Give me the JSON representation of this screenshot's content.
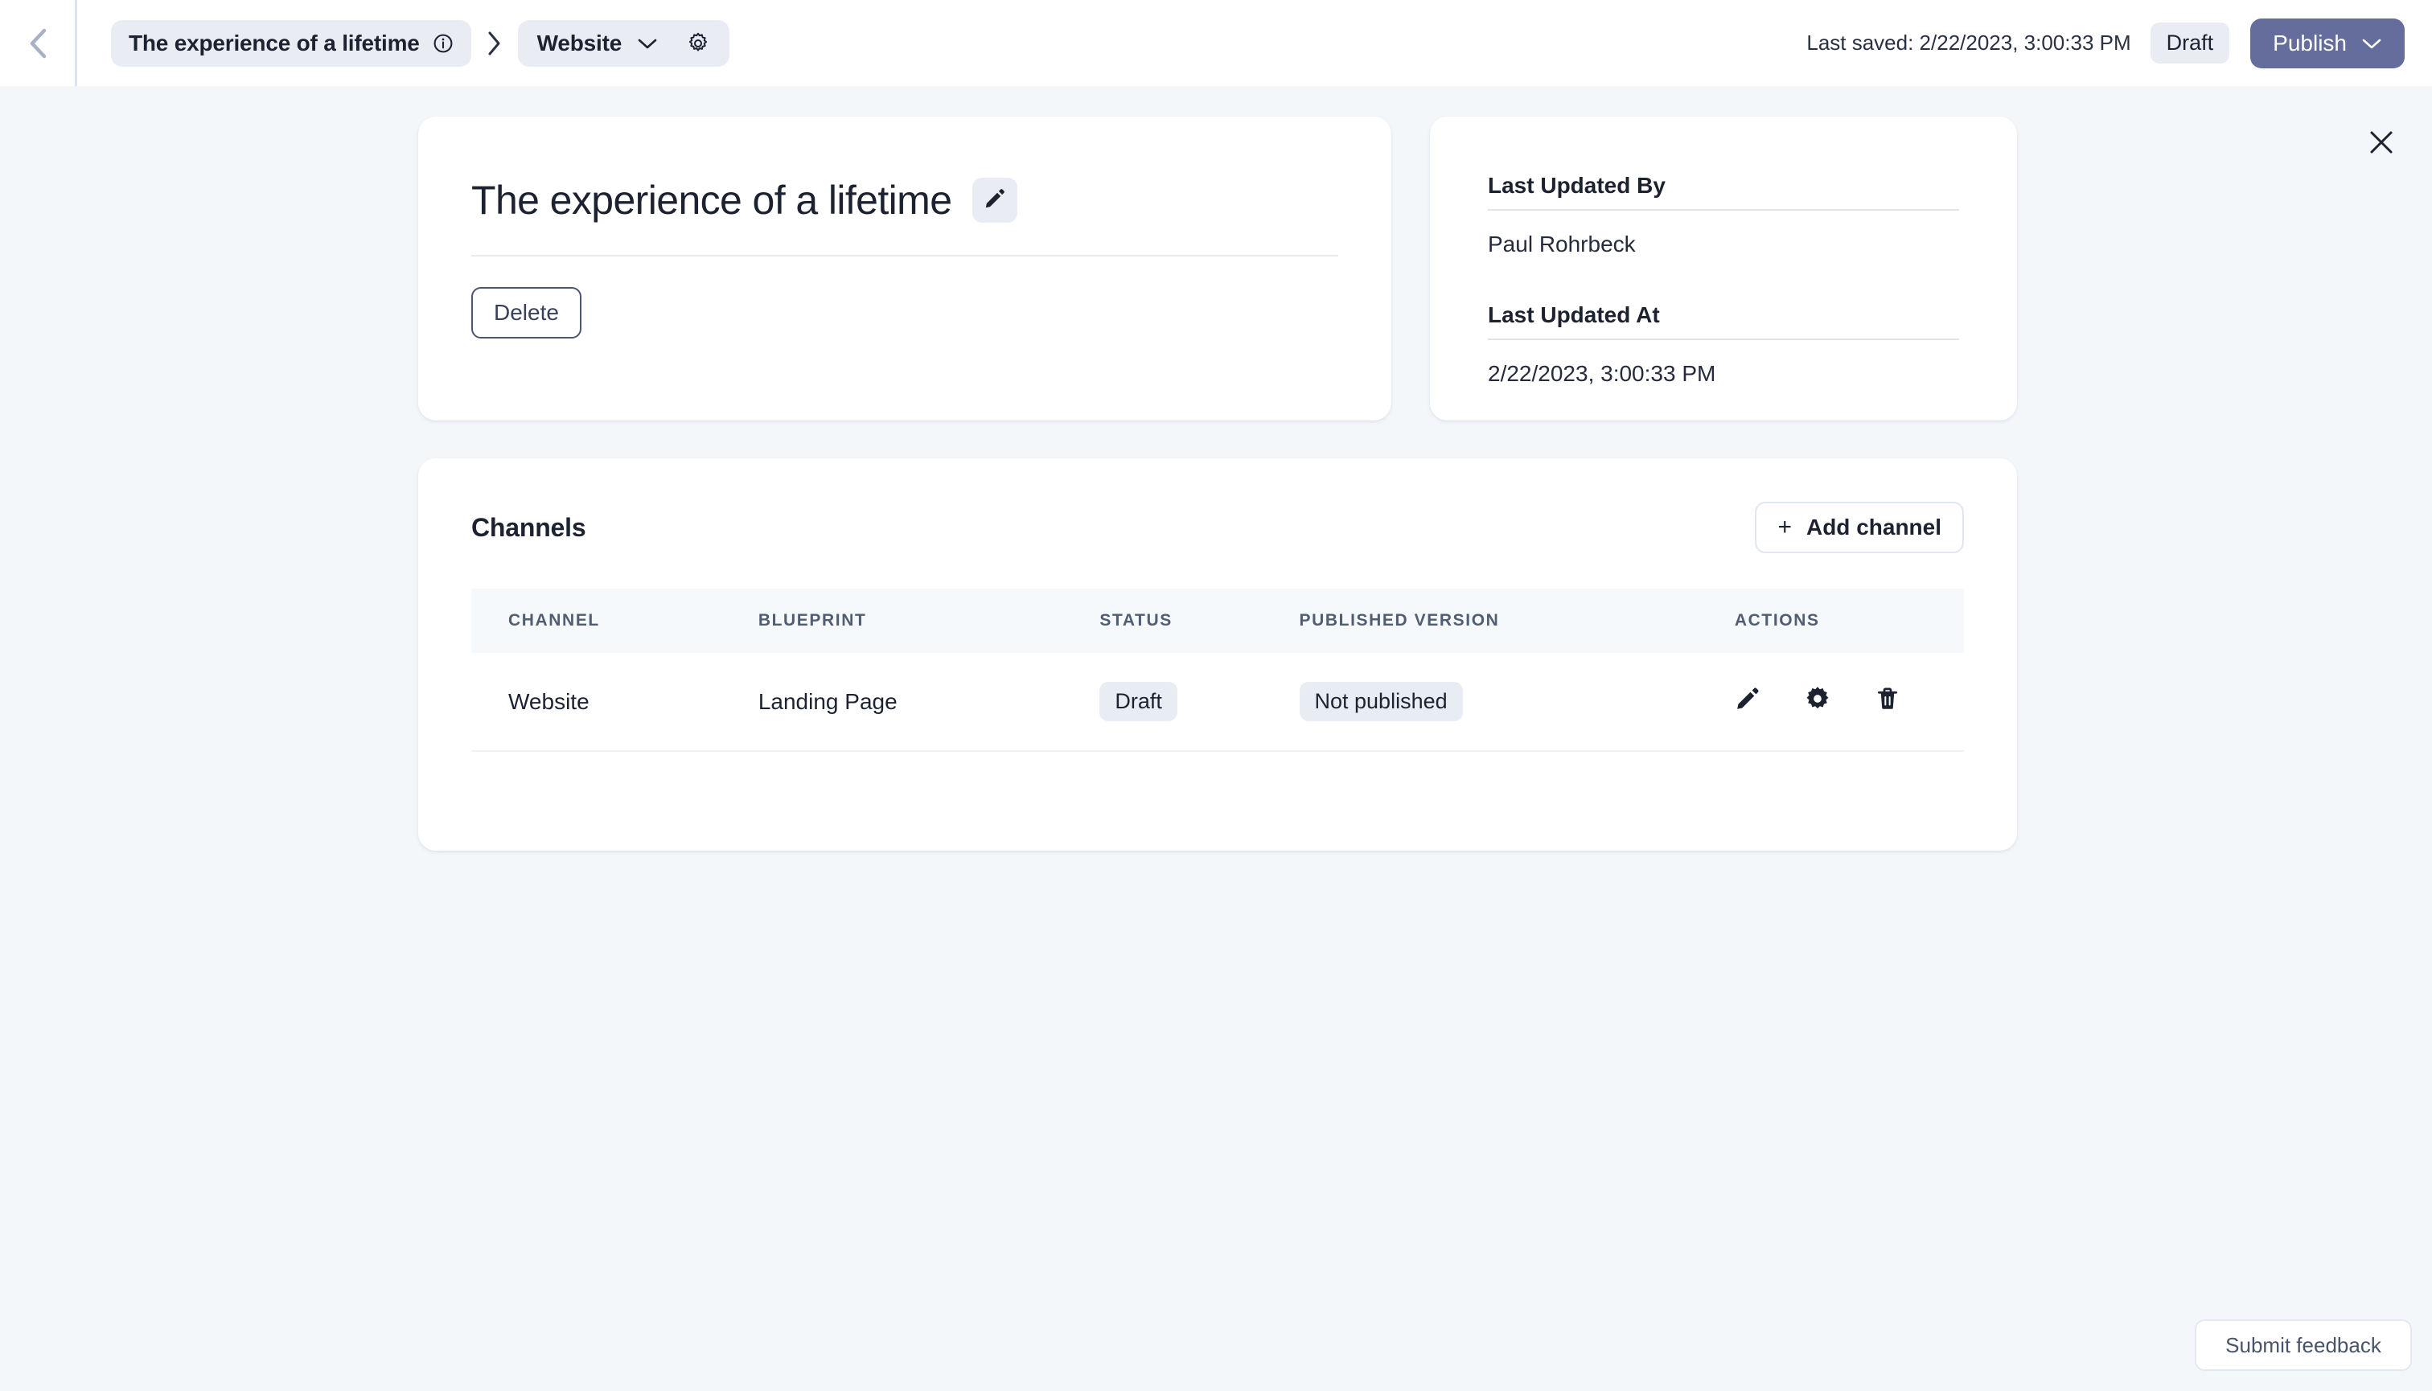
{
  "topbar": {
    "back_icon": "chevron-left-icon",
    "breadcrumb": {
      "entry_label": "The experience of a lifetime",
      "entry_info_icon": "info-circle-icon",
      "separator_icon": "chevron-right-icon",
      "channel_label": "Website",
      "channel_dropdown_icon": "chevron-down-icon",
      "settings_icon": "gear-icon"
    },
    "last_saved": "Last saved: 2/22/2023, 3:00:33 PM",
    "status_chip": "Draft",
    "publish_label": "Publish",
    "publish_dropdown_icon": "chevron-down-icon",
    "publish_color": "#646D9C"
  },
  "close_icon": "close-icon",
  "title_card": {
    "title": "The experience of a lifetime",
    "edit_icon": "pencil-icon",
    "delete_label": "Delete"
  },
  "meta_card": {
    "updated_by_label": "Last Updated By",
    "updated_by_value": "Paul Rohrbeck",
    "updated_at_label": "Last Updated At",
    "updated_at_value": "2/22/2023, 3:00:33 PM"
  },
  "channels": {
    "section_title": "Channels",
    "add_button_label": "Add channel",
    "add_button_icon": "plus-icon",
    "columns": [
      "CHANNEL",
      "BLUEPRINT",
      "STATUS",
      "PUBLISHED VERSION",
      "ACTIONS"
    ],
    "rows": [
      {
        "channel": "Website",
        "blueprint": "Landing Page",
        "status": "Draft",
        "published_version": "Not published",
        "actions": [
          "pencil-icon",
          "gear-icon",
          "trash-icon"
        ]
      }
    ]
  },
  "feedback": {
    "label": "Submit feedback"
  }
}
